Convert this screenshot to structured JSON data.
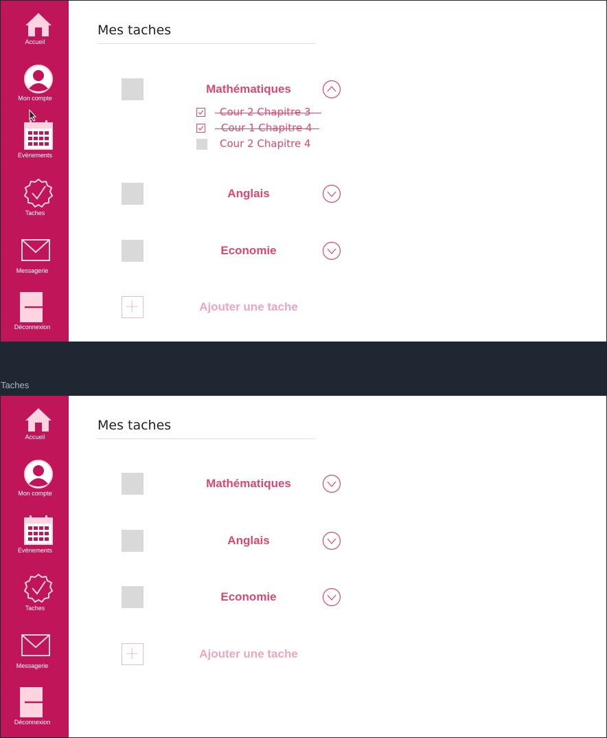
{
  "colors": {
    "sidebar": "#c01558",
    "accent": "#e0466f",
    "accent_light": "#f0a5bd",
    "divider": "#1f2733"
  },
  "sidebar": {
    "items": [
      {
        "label": "Accueil",
        "icon": "home-icon"
      },
      {
        "label": "Mon compte",
        "icon": "user-icon"
      },
      {
        "label": "Evènements",
        "icon": "calendar-icon"
      },
      {
        "label": "Taches",
        "icon": "check-badge-icon"
      },
      {
        "label": "Messagerie",
        "icon": "mail-icon"
      },
      {
        "label": "Déconnexion",
        "icon": "logout-icon"
      }
    ]
  },
  "window_caption": "Taches",
  "top_panel": {
    "title": "Mes taches",
    "tasks": [
      {
        "subject": "Mathématiques",
        "expanded": true,
        "subtasks": [
          {
            "label": "Cour 2 Chapitre 3",
            "done": true
          },
          {
            "label": "Cour 1 Chapitre 4",
            "done": true
          },
          {
            "label": "Cour 2 Chapitre 4",
            "done": false
          }
        ]
      },
      {
        "subject": "Anglais",
        "expanded": false
      },
      {
        "subject": "Economie",
        "expanded": false
      }
    ],
    "add_label": "Ajouter une tache"
  },
  "bottom_panel": {
    "title": "Mes taches",
    "tasks": [
      {
        "subject": "Mathématiques",
        "expanded": false
      },
      {
        "subject": "Anglais",
        "expanded": false
      },
      {
        "subject": "Economie",
        "expanded": false
      }
    ],
    "add_label": "Ajouter une tache"
  }
}
